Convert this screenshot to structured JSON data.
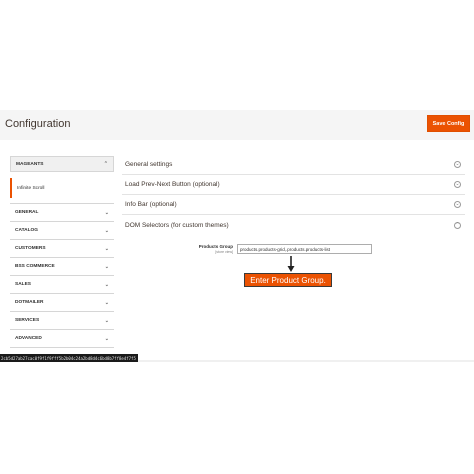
{
  "header": {
    "title": "Configuration",
    "save_label": "Save Config"
  },
  "sidebar": {
    "group_title": "MAGEANTS",
    "active_item": "Infinite Scroll",
    "items": [
      {
        "label": "GENERAL"
      },
      {
        "label": "CATALOG"
      },
      {
        "label": "CUSTOMERS"
      },
      {
        "label": "BSS COMMERCE"
      },
      {
        "label": "SALES"
      },
      {
        "label": "DOTMAILER"
      },
      {
        "label": "SERVICES"
      },
      {
        "label": "ADVANCED"
      }
    ]
  },
  "sections": [
    {
      "label": "General settings",
      "state": "collapsed"
    },
    {
      "label": "Load Prev-Next Button (optional)",
      "state": "collapsed"
    },
    {
      "label": "Info Bar (optional)",
      "state": "collapsed"
    },
    {
      "label": "DOM Selectors (for custom themes)",
      "state": "expanded"
    }
  ],
  "field": {
    "label": "Products Group",
    "scope": "[store view]",
    "value": "products.products-grid,.products.products-list"
  },
  "callout": {
    "text": "Enter Product Group."
  },
  "status_bar": {
    "text": "2cb5d27ab27cac0f9f1f9fff5b2b04c24a2bd8d4c6bd8b7ff8e4f7f5"
  },
  "colors": {
    "accent": "#eb5202"
  }
}
